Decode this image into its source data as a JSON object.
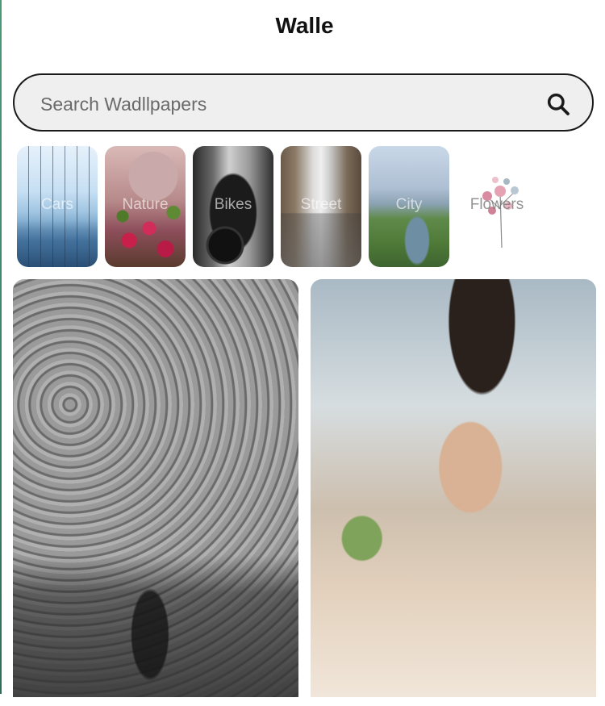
{
  "app": {
    "title": "Walle"
  },
  "search": {
    "placeholder": "Search Wadllpapers",
    "icon": "search-icon"
  },
  "categories": [
    {
      "label": "Cars"
    },
    {
      "label": "Nature"
    },
    {
      "label": "Bikes"
    },
    {
      "label": "Street"
    },
    {
      "label": "City"
    },
    {
      "label": "Flowers"
    }
  ],
  "colors": {
    "accent": "#1a1a1a",
    "search_bg": "#efefef",
    "edge": "#3f8a6c"
  }
}
